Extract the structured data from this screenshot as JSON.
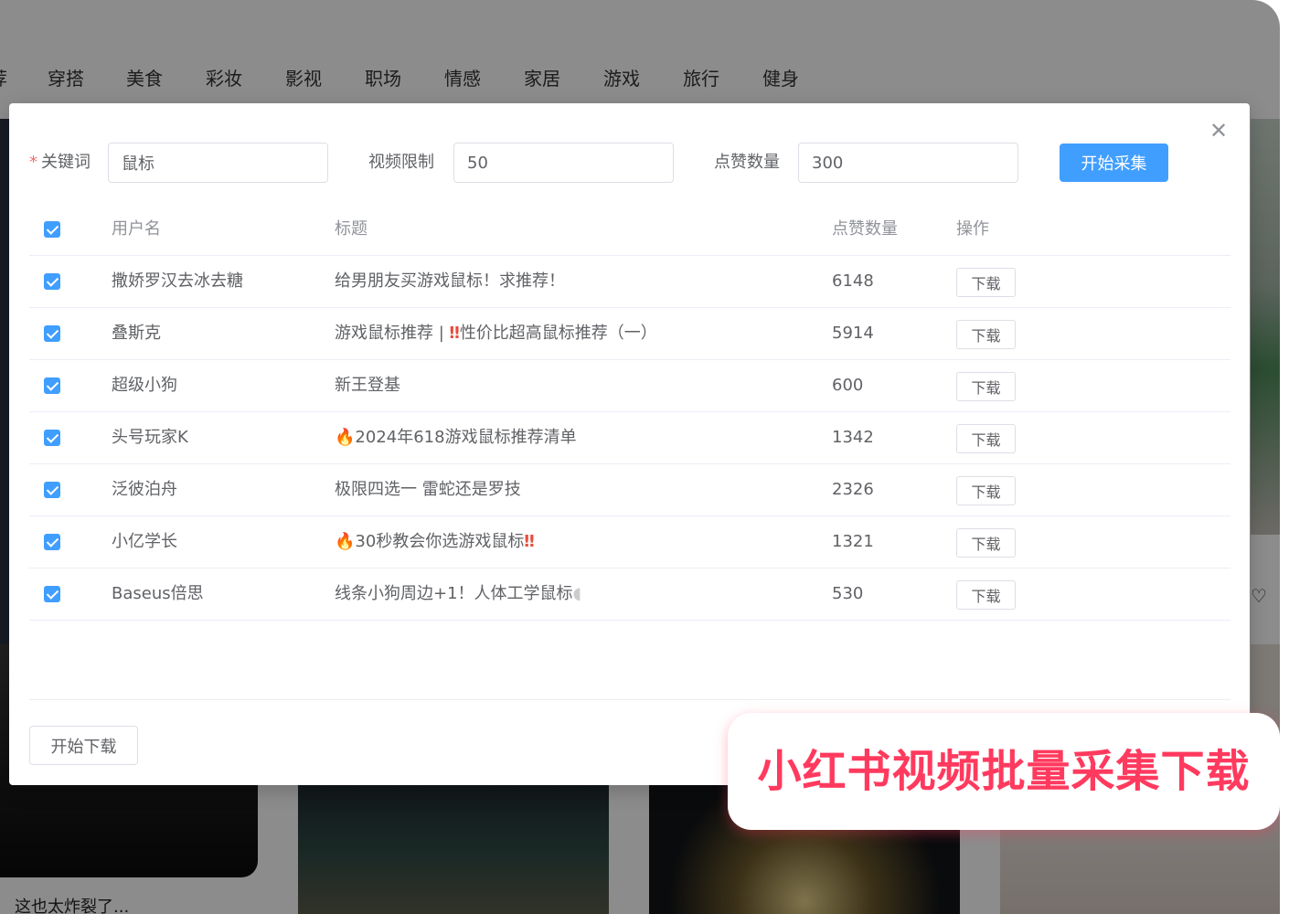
{
  "background": {
    "nav_categories": [
      "荐",
      "穿搭",
      "美食",
      "彩妆",
      "影视",
      "职场",
      "情感",
      "家居",
      "游戏",
      "旅行",
      "健身"
    ],
    "caption": "这也太炸裂了..."
  },
  "modal": {
    "close_icon": "close-icon",
    "form": {
      "keyword_label": "关键词",
      "keyword_required_mark": "*",
      "keyword_value": "鼠标",
      "video_limit_label": "视频限制",
      "video_limit_value": "50",
      "likes_label": "点赞数量",
      "likes_value": "300",
      "start_collect_label": "开始采集"
    },
    "table": {
      "headers": {
        "user": "用户名",
        "title": "标题",
        "likes": "点赞数量",
        "op": "操作"
      },
      "download_label": "下载",
      "rows": [
        {
          "user": "撒娇罗汉去冰去糖",
          "title_pre": "",
          "title": "给男朋友买游戏鼠标！求推荐！",
          "title_post": "",
          "likes": "6148",
          "checked": true
        },
        {
          "user": "叠斯克",
          "title_pre": "",
          "title": "游戏鼠标推荐 | ",
          "title_post": "性价比超高鼠标推荐（一）",
          "likes": "5914",
          "checked": true
        },
        {
          "user": "超级小狗",
          "title_pre": "",
          "title": "新王登基",
          "title_post": "",
          "likes": "600",
          "checked": true
        },
        {
          "user": "头号玩家K",
          "title_pre": "🔥",
          "title": "2024年618游戏鼠标推荐清单",
          "title_post": "",
          "likes": "1342",
          "checked": true
        },
        {
          "user": "泛彼泊舟",
          "title_pre": "",
          "title": "极限四选一 雷蛇还是罗技",
          "title_post": "",
          "likes": "2326",
          "checked": true
        },
        {
          "user": "小亿学长",
          "title_pre": "🔥",
          "title": "30秒教会你选游戏鼠标",
          "title_post": "",
          "likes": "1321",
          "checked": true
        },
        {
          "user": "Baseus倍思",
          "title_pre": "",
          "title": "线条小狗周边+1！人体工学鼠标",
          "title_post": "",
          "likes": "530",
          "checked": true
        }
      ]
    },
    "start_download_label": "开始下载"
  },
  "banner": {
    "text": "小红书视频批量采集下载"
  },
  "colors": {
    "primary": "#409eff",
    "banner_text": "#ff3a5e",
    "required": "#f56c6c"
  }
}
